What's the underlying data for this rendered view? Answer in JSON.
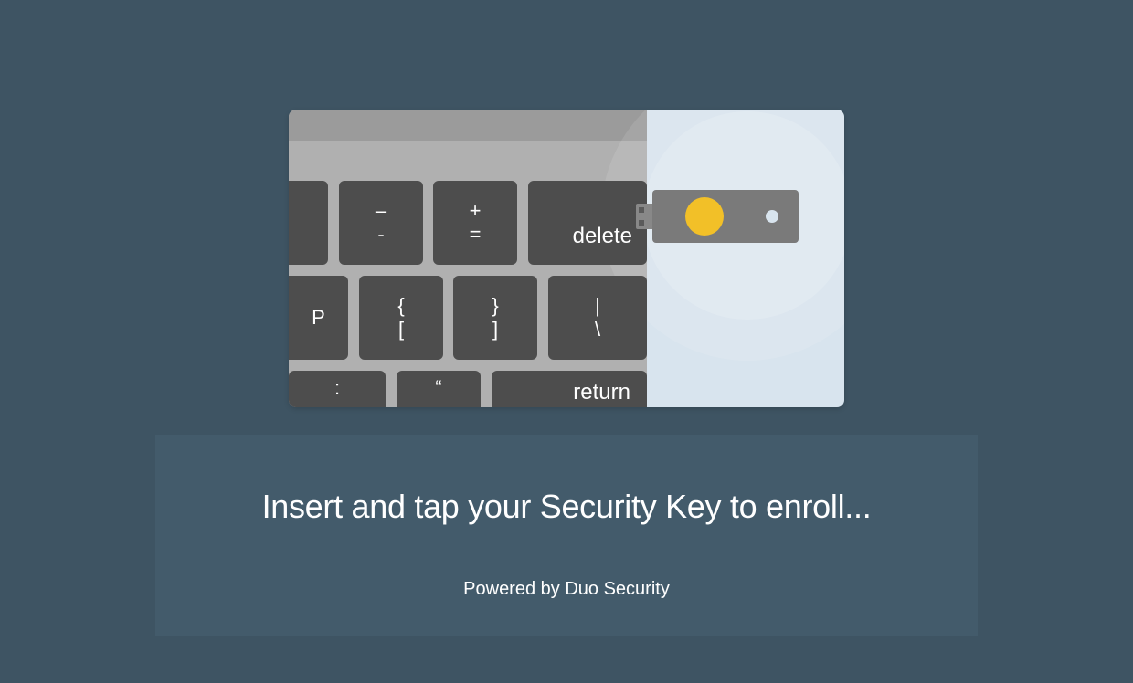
{
  "prompt": {
    "heading": "Insert and tap your Security Key to enroll...",
    "powered_by": "Powered by Duo Security"
  },
  "illustration": {
    "keys": {
      "minus": {
        "upper": "–",
        "lower": "-"
      },
      "plus": {
        "upper": "+",
        "lower": "="
      },
      "delete": "delete",
      "p": "P",
      "bracket_open": {
        "upper": "{",
        "lower": "["
      },
      "bracket_close": {
        "upper": "}",
        "lower": "]"
      },
      "pipe": {
        "upper": "|",
        "lower": "\\"
      },
      "colon": ":",
      "quote": "“",
      "return": "return"
    },
    "security_key_icon": "security-key-icon"
  }
}
